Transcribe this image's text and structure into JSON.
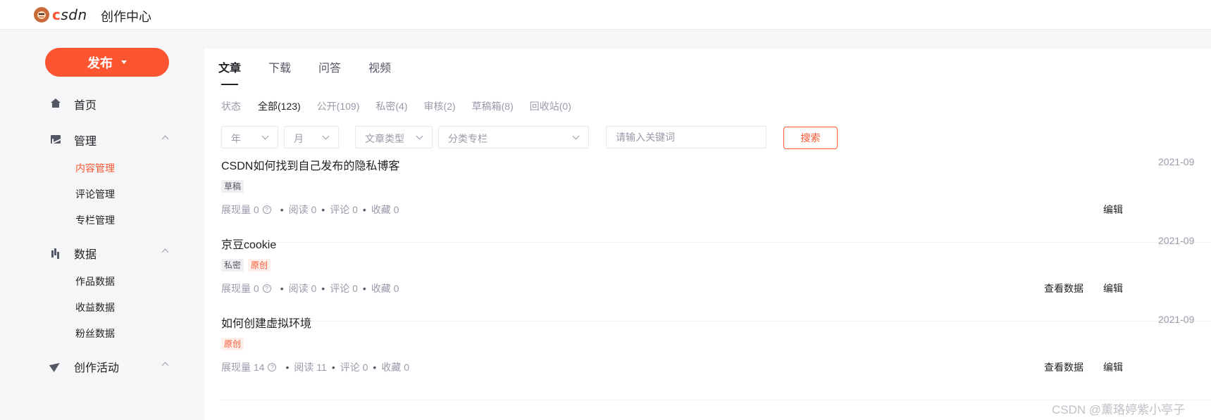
{
  "header": {
    "logo_text": "CSDN",
    "title": "创作中心"
  },
  "sidebar": {
    "publish_label": "发布",
    "home": "首页",
    "manage": {
      "label": "管理",
      "items": [
        "内容管理",
        "评论管理",
        "专栏管理"
      ]
    },
    "data": {
      "label": "数据",
      "items": [
        "作品数据",
        "收益数据",
        "粉丝数据"
      ]
    },
    "activity": {
      "label": "创作活动"
    }
  },
  "tabs": [
    "文章",
    "下载",
    "问答",
    "视频"
  ],
  "status": {
    "label": "状态",
    "filters": [
      "全部(123)",
      "公开(109)",
      "私密(4)",
      "审核(2)",
      "草稿箱(8)",
      "回收站(0)"
    ]
  },
  "filters": {
    "year": "年",
    "month": "月",
    "type": "文章类型",
    "column": "分类专栏",
    "search_placeholder": "请输入关键词",
    "search_button": "搜索"
  },
  "articles": [
    {
      "title": "CSDN如何找到自己发布的隐私博客",
      "date": "2021-09",
      "tags": [
        "草稿"
      ],
      "impressions": "展现量 0",
      "reads": "阅读 0",
      "comments": "评论 0",
      "favorites": "收藏 0",
      "view_data": "",
      "edit": "编辑"
    },
    {
      "title": "京豆cookie",
      "date": "2021-09",
      "tags": [
        "私密",
        "原创"
      ],
      "impressions": "展现量 0",
      "reads": "阅读 0",
      "comments": "评论 0",
      "favorites": "收藏 0",
      "view_data": "查看数据",
      "edit": "编辑"
    },
    {
      "title": "如何创建虚拟环境",
      "date": "2021-09",
      "tags": [
        "原创"
      ],
      "impressions": "展现量 14",
      "reads": "阅读 11",
      "comments": "评论 0",
      "favorites": "收藏 0",
      "view_data": "查看数据",
      "edit": "编辑"
    }
  ],
  "watermark": "CSDN @薰珞婷紫小亭子",
  "colors": {
    "accent": "#fc5531",
    "text": "#222226",
    "muted": "#999aaa",
    "bg": "#f5f6f7"
  }
}
